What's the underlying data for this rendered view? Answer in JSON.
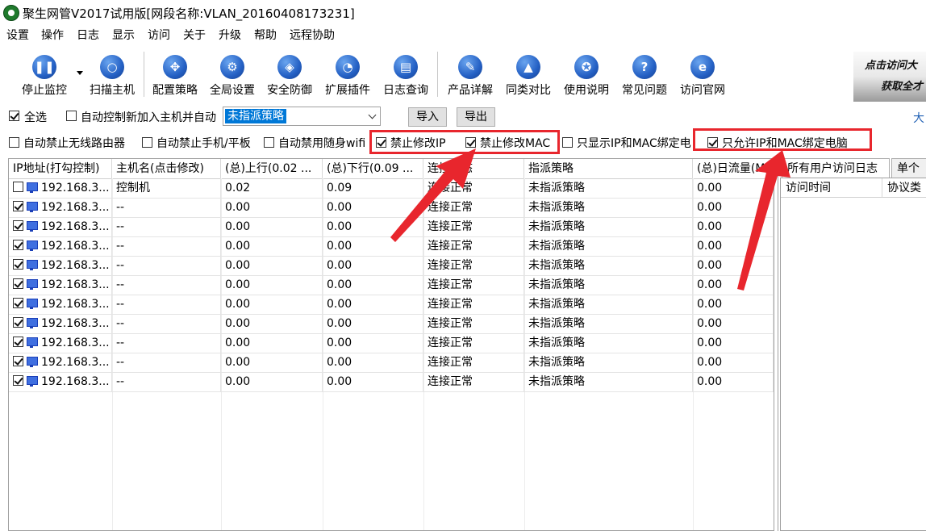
{
  "window": {
    "title": "聚生网管V2017试用版[网段名称:VLAN_20160408173231]"
  },
  "menu": [
    "设置",
    "操作",
    "日志",
    "显示",
    "访问",
    "关于",
    "升级",
    "帮助",
    "远程协助"
  ],
  "toolbar": {
    "stop_monitor": "停止监控",
    "scan_host": "扫描主机",
    "config_policy": "配置策略",
    "global_settings": "全局设置",
    "security": "安全防御",
    "plugins": "扩展插件",
    "log_query": "日志查询",
    "product_detail": "产品详解",
    "compare": "同类对比",
    "manual": "使用说明",
    "faq": "常见问题",
    "website": "访问官网"
  },
  "banner": {
    "line1": "点击访问大",
    "line2": "获取全才"
  },
  "controls": {
    "select_all": "全选",
    "auto_control_new": "自动控制新加入主机并自动",
    "policy_value": "未指派策略",
    "import": "导入",
    "export": "导出",
    "right_hint": "大"
  },
  "options": {
    "disable_router": "自动禁止无线路由器",
    "disable_phone": "自动禁止手机/平板",
    "disable_wifi": "自动禁用随身wifi",
    "forbid_ip": "禁止修改IP",
    "forbid_mac": "禁止修改MAC",
    "show_bound": "只显示IP和MAC绑定电",
    "allow_bound": "只允许IP和MAC绑定电脑"
  },
  "table": {
    "headers": [
      "IP地址(打勾控制)",
      "主机名(点击修改)",
      "(总)上行(0.02 ...",
      "(总)下行(0.09 ...",
      "连接状态",
      "指派策略",
      "(总)日流量(M)"
    ],
    "rows": [
      {
        "checked": false,
        "ip": "192.168.3...",
        "host": "控制机",
        "up": "0.02",
        "down": "0.09",
        "status": "连接正常",
        "policy": "未指派策略",
        "daily": "0.00"
      },
      {
        "checked": true,
        "ip": "192.168.3...",
        "host": "--",
        "up": "0.00",
        "down": "0.00",
        "status": "连接正常",
        "policy": "未指派策略",
        "daily": "0.00"
      },
      {
        "checked": true,
        "ip": "192.168.3...",
        "host": "--",
        "up": "0.00",
        "down": "0.00",
        "status": "连接正常",
        "policy": "未指派策略",
        "daily": "0.00"
      },
      {
        "checked": true,
        "ip": "192.168.3...",
        "host": "--",
        "up": "0.00",
        "down": "0.00",
        "status": "连接正常",
        "policy": "未指派策略",
        "daily": "0.00"
      },
      {
        "checked": true,
        "ip": "192.168.3...",
        "host": "--",
        "up": "0.00",
        "down": "0.00",
        "status": "连接正常",
        "policy": "未指派策略",
        "daily": "0.00"
      },
      {
        "checked": true,
        "ip": "192.168.3...",
        "host": "--",
        "up": "0.00",
        "down": "0.00",
        "status": "连接正常",
        "policy": "未指派策略",
        "daily": "0.00"
      },
      {
        "checked": true,
        "ip": "192.168.3...",
        "host": "--",
        "up": "0.00",
        "down": "0.00",
        "status": "连接正常",
        "policy": "未指派策略",
        "daily": "0.00"
      },
      {
        "checked": true,
        "ip": "192.168.3...",
        "host": "--",
        "up": "0.00",
        "down": "0.00",
        "status": "连接正常",
        "policy": "未指派策略",
        "daily": "0.00"
      },
      {
        "checked": true,
        "ip": "192.168.3...",
        "host": "--",
        "up": "0.00",
        "down": "0.00",
        "status": "连接正常",
        "policy": "未指派策略",
        "daily": "0.00"
      },
      {
        "checked": true,
        "ip": "192.168.3...",
        "host": "--",
        "up": "0.00",
        "down": "0.00",
        "status": "连接正常",
        "policy": "未指派策略",
        "daily": "0.00"
      },
      {
        "checked": true,
        "ip": "192.168.3...",
        "host": "--",
        "up": "0.00",
        "down": "0.00",
        "status": "连接正常",
        "policy": "未指派策略",
        "daily": "0.00"
      }
    ]
  },
  "side": {
    "tab_all_logs": "所有用户访问日志",
    "tab_single": "单个",
    "col_time": "访问时间",
    "col_protocol": "协议类"
  },
  "colors": {
    "accent": "#0078d7",
    "annotation": "#e8262d"
  }
}
